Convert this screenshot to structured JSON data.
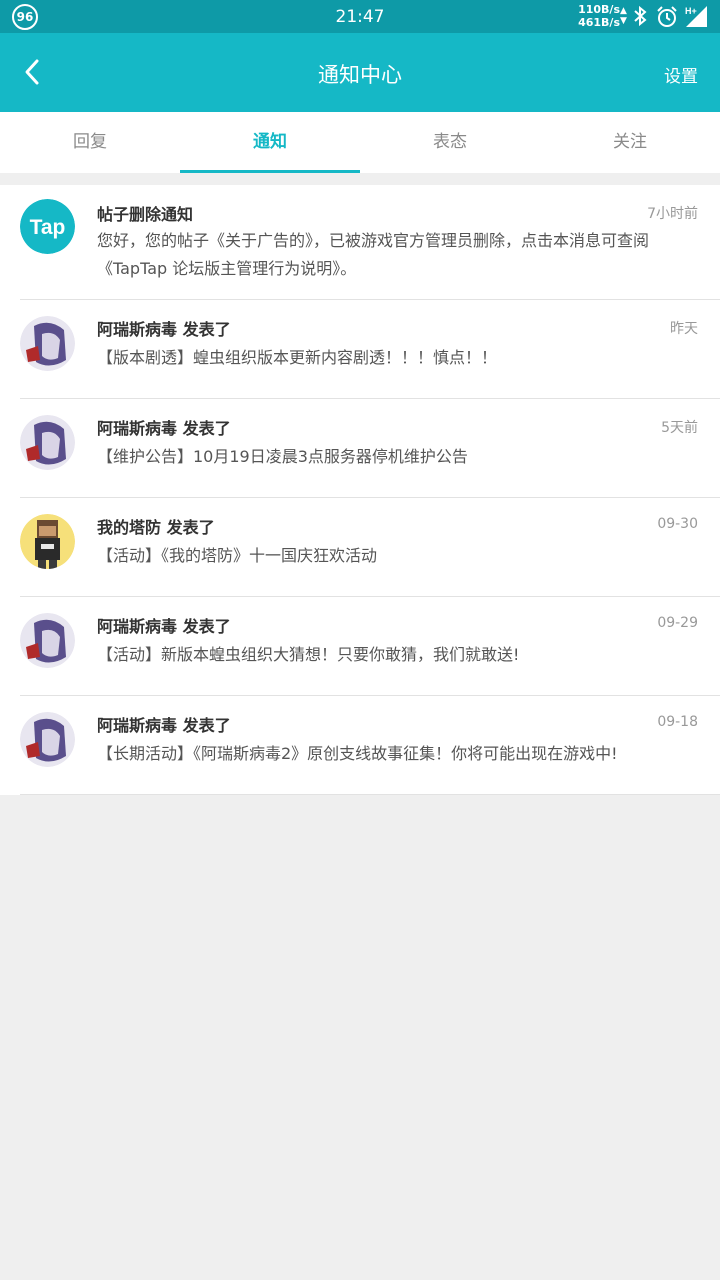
{
  "statusbar": {
    "badge": "96",
    "time": "21:47",
    "net_up": "110B/s",
    "net_down": "461B/s",
    "network": "H+"
  },
  "header": {
    "title": "通知中心",
    "settings_label": "设置"
  },
  "tabs": [
    {
      "label": "回复"
    },
    {
      "label": "通知"
    },
    {
      "label": "表态"
    },
    {
      "label": "关注"
    }
  ],
  "notifications": [
    {
      "name": "帖子删除通知",
      "time": "7小时前",
      "message": "您好，您的帖子《关于广告的》，已被游戏官方管理员删除，点击本消息可查阅《TapTap 论坛版主管理行为说明》。",
      "avatar_text": "Tap"
    },
    {
      "name": "阿瑞斯病毒 发表了",
      "time": "昨天",
      "message": "【版本剧透】蝗虫组织版本更新内容剧透！！！慎点！！"
    },
    {
      "name": "阿瑞斯病毒 发表了",
      "time": "5天前",
      "message": "【维护公告】10月19日凌晨3点服务器停机维护公告"
    },
    {
      "name": "我的塔防 发表了",
      "time": "09-30",
      "message": "【活动】《我的塔防》十一国庆狂欢活动"
    },
    {
      "name": "阿瑞斯病毒 发表了",
      "time": "09-29",
      "message": "【活动】新版本蝗虫组织大猜想！只要你敢猜，我们就敢送!"
    },
    {
      "name": "阿瑞斯病毒 发表了",
      "time": "09-18",
      "message": "【长期活动】《阿瑞斯病毒2》原创支线故事征集！你将可能出现在游戏中!"
    }
  ],
  "colors": {
    "statusbar": "#0e9aa7",
    "accent": "#15b8c6",
    "background": "#efefef"
  }
}
